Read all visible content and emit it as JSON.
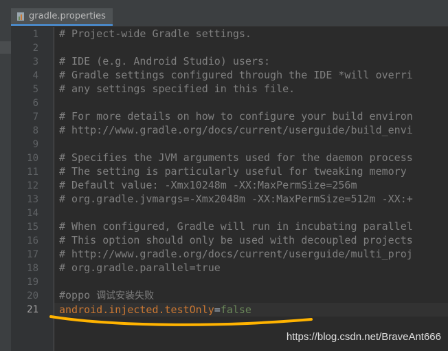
{
  "tab": {
    "title": "gradle.properties"
  },
  "lines": [
    "# Project-wide Gradle settings.",
    "",
    "# IDE (e.g. Android Studio) users:",
    "# Gradle settings configured through the IDE *will overri",
    "# any settings specified in this file.",
    "",
    "# For more details on how to configure your build environ",
    "# http://www.gradle.org/docs/current/userguide/build_envi",
    "",
    "# Specifies the JVM arguments used for the daemon process",
    "# The setting is particularly useful for tweaking memory ",
    "# Default value: -Xmx10248m -XX:MaxPermSize=256m",
    "# org.gradle.jvmargs=-Xmx2048m -XX:MaxPermSize=512m -XX:+",
    "",
    "# When configured, Gradle will run in incubating parallel",
    "# This option should only be used with decoupled projects",
    "# http://www.gradle.org/docs/current/userguide/multi_proj",
    "# org.gradle.parallel=true",
    "",
    {
      "prefix": "#oppo ",
      "cn": "调试安装失败"
    },
    {
      "key": "android.injected.testOnly",
      "eq": "=",
      "value": "false"
    }
  ],
  "line_numbers": [
    "1",
    "2",
    "3",
    "4",
    "5",
    "6",
    "7",
    "8",
    "9",
    "10",
    "11",
    "12",
    "13",
    "14",
    "15",
    "16",
    "17",
    "18",
    "19",
    "20",
    "21"
  ],
  "current_line": 21,
  "colors": {
    "background": "#2b2b2b",
    "gutter": "#313335",
    "comment": "#808080",
    "key": "#cc7832",
    "value": "#6a8759",
    "annotation": "#ffb300"
  },
  "watermark": "https://blog.csdn.net/BraveAnt666"
}
